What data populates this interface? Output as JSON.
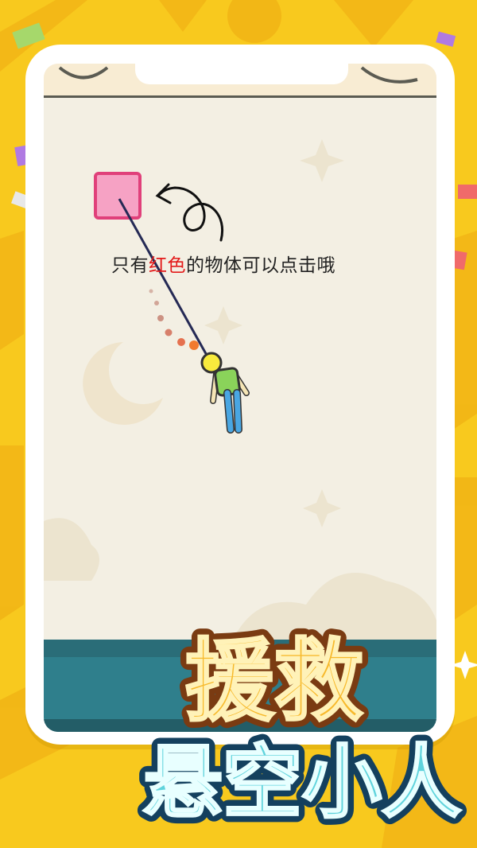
{
  "instruction": {
    "prefix": "只有",
    "highlight": "红色",
    "suffix": "的物体可以点击哦"
  },
  "title": {
    "line1": "援救",
    "line2": "悬空小人"
  },
  "colors": {
    "background": "#f8c91e",
    "screen": "#f3efe3",
    "water": "#2f7f8c",
    "title_fill": "#f7b92b",
    "title_line2_fill": "#5fd3dc",
    "highlight_text": "#e31a1a",
    "red_box_fill": "#f6a2c4",
    "red_box_border": "#e0407a"
  }
}
